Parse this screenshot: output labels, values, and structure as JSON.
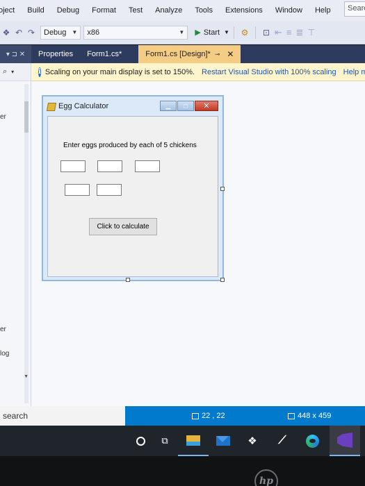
{
  "menu": {
    "items": [
      "oject",
      "Build",
      "Debug",
      "Format",
      "Test",
      "Analyze",
      "Tools",
      "Extensions",
      "Window",
      "Help"
    ],
    "search_label": "Searc"
  },
  "toolbar": {
    "config": "Debug",
    "platform": "x86",
    "start_label": "Start"
  },
  "tabs": {
    "pane_controls": "▾ ⊐ ✕",
    "properties": "Properties",
    "form1_cs": "Form1.cs*",
    "form1_design": "Form1.cs [Design]*"
  },
  "infobar": {
    "message": "Scaling on your main display is set to 150%.",
    "restart_link": "Restart Visual Studio with 100% scaling",
    "help_link": "Help m"
  },
  "leftpane": {
    "texts": [
      "er",
      "er",
      "log"
    ]
  },
  "form": {
    "title": "Egg Calculator",
    "prompt": "Enter eggs produced by each of 5 chickens",
    "button_label": "Click to calculate",
    "textbox_count": 5
  },
  "statusbar": {
    "search_label": "search",
    "coords": "22 , 22",
    "size": "448 x 459"
  },
  "taskbar": {
    "icons": [
      "cortana-icon",
      "task-view-icon",
      "file-explorer-icon",
      "mail-icon",
      "dropbox-icon",
      "vs-code-icon",
      "edge-icon",
      "visual-studio-icon"
    ]
  },
  "bezel": {
    "logo": "hp"
  },
  "colors": {
    "tab_strip": "#2d3b5f",
    "active_tab": "#f5cc84",
    "statusbar": "#007acc",
    "infobar": "#fff5cc"
  }
}
